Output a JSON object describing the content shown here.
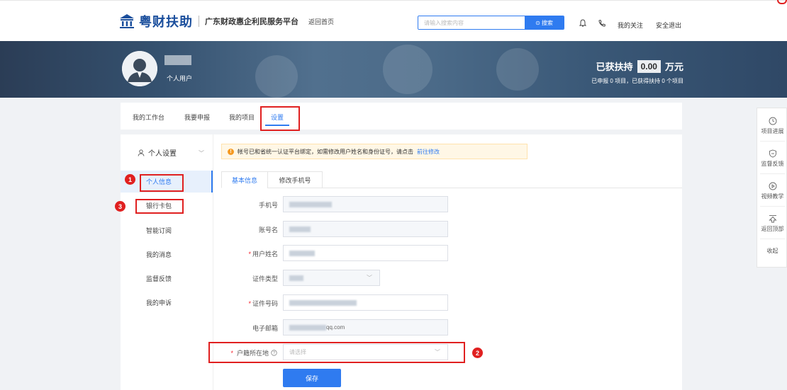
{
  "header": {
    "logo_text": "粤财扶助",
    "platform_name": "广东财政惠企利民服务平台",
    "back_home": "返回首页",
    "search_placeholder": "请输入搜索内容",
    "search_button": "搜索",
    "my_follow": "我的关注",
    "logout": "安全退出"
  },
  "banner": {
    "user_type": "个人用户",
    "support_label": "已获扶持",
    "support_amount": "0.00",
    "support_unit": "万元",
    "support_sub": "已申报 0 项目，已获得扶持 0 个项目"
  },
  "tabs": [
    "我的工作台",
    "我要申报",
    "我的项目",
    "设置"
  ],
  "sidebar": {
    "heading": "个人设置",
    "items": [
      "个人信息",
      "银行卡包",
      "智能订阅",
      "我的消息",
      "监督反馈",
      "我的申诉"
    ]
  },
  "notice": {
    "text": "帐号已和省统一认证平台绑定，如需修改用户姓名和身份证号，请点击",
    "link": "前往修改"
  },
  "subtabs": [
    "基本信息",
    "修改手机号"
  ],
  "form": {
    "phone_label": "手机号",
    "account_label": "账号名",
    "name_label": "用户姓名",
    "id_type_label": "证件类型",
    "id_no_label": "证件号码",
    "email_label": "电子邮箱",
    "email_value": "qq.com",
    "domicile_label": "户籍所在地",
    "domicile_placeholder": "请选择",
    "save_button": "保存"
  },
  "markers": [
    "1",
    "2",
    "3"
  ],
  "float_panel": {
    "items": [
      "项目进展",
      "监督反馈",
      "视频教学",
      "返回顶部"
    ],
    "collapse": "收起"
  },
  "colors": {
    "accent": "#2f7bf0",
    "annotation_red": "#e02020",
    "brand": "#1a4e9c"
  }
}
